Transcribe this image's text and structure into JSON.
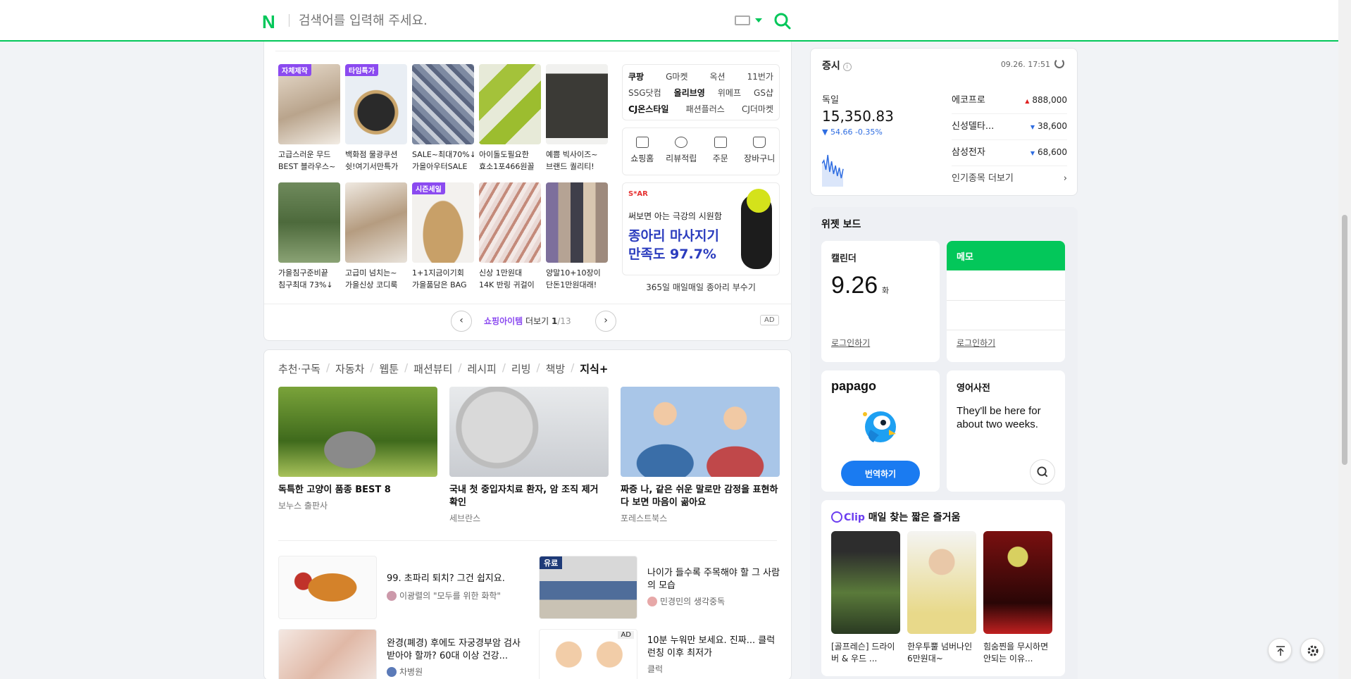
{
  "header": {
    "logo": "N",
    "search_placeholder": "검색어를 입력해 주세요."
  },
  "shopping": {
    "products": [
      {
        "badge": "자체제작",
        "line1": "고급스러운 무드",
        "line2": "BEST 블라우스~"
      },
      {
        "badge": "타임특가",
        "line1": "백화점 물광쿠션",
        "line2": "쉿!여기서만특가"
      },
      {
        "badge": "",
        "line1": "SALE~최대70%↓",
        "line2": "가을아우터SALE"
      },
      {
        "badge": "",
        "line1": "아이돌도필요한",
        "line2": "효소1포466원꼴"
      },
      {
        "badge": "",
        "line1": "예쁨 빅사이즈~",
        "line2": "브랜드 퀄리티!"
      },
      {
        "badge": "",
        "line1": "가을침구준비끝",
        "line2": "침구최대 73%↓"
      },
      {
        "badge": "",
        "line1": "고급미 넘치는~",
        "line2": "가을신상 코디룩"
      },
      {
        "badge": "시즌세일",
        "line1": "1+1지금이기회",
        "line2": "가을품담은 BAG"
      },
      {
        "badge": "",
        "line1": "신상 1만원대",
        "line2": "14K 반링 귀걸이"
      },
      {
        "badge": "",
        "line1": "양말10+10장이",
        "line2": "단돈1만원대래!"
      }
    ],
    "malls": [
      [
        "쿠팡",
        "G마켓",
        "옥션",
        "11번가"
      ],
      [
        "SSG닷컴",
        "올리브영",
        "위메프",
        "GS샵"
      ],
      [
        "CJ온스타일",
        "패션플러스",
        "CJ더마켓"
      ]
    ],
    "shortcuts": [
      "쇼핑홈",
      "리뷰적립",
      "주문",
      "장바구니"
    ],
    "ad": {
      "brand": "S*AR",
      "line1": "써보면 아는 극강의 시원함",
      "line2": "종아리 마사지기",
      "line3": "만족도 97.7%",
      "caption": "365일 매일매일 종아리 부수기"
    },
    "pager": {
      "prev": "‹",
      "next": "›",
      "accent": "쇼핑아이템",
      "more": "더보기",
      "current": "1",
      "total": "/13",
      "ad_tag": "AD"
    }
  },
  "content": {
    "tabs": [
      "추천·구독",
      "자동차",
      "웹툰",
      "패션뷰티",
      "레시피",
      "리빙",
      "책방",
      "지식+"
    ],
    "features": [
      {
        "title": "독특한 고양이 품종 BEST 8",
        "source": "보누스 출판사"
      },
      {
        "title": "국내 첫 중입자치료 환자, 암 조직 제거 확인",
        "source": "세브란스"
      },
      {
        "title": "짜증 나, 같은 쉬운 말로만 감정을 표현하다 보면 마음이 곪아요",
        "source": "포레스트북스"
      }
    ],
    "articles": [
      {
        "title": "99. 초파리 퇴치? 그건 쉽지요.",
        "source": "이광렬의 \"모두를 위한 화학\""
      },
      {
        "badge": "유료",
        "title": "나이가 들수록 주목해야 할 그 사람의 모습",
        "source": "민경민의 생각중독"
      },
      {
        "title": "완경(폐경) 후에도 자궁경부암 검사받아야 할까? 60대 이상 건강...",
        "source": "차병원"
      },
      {
        "title": "10분 누워만 보세요. 진짜... 클럭 런칭 이후 최저가",
        "source": "클럭",
        "ad": "AD"
      }
    ]
  },
  "stocks": {
    "title": "증시",
    "info": "i",
    "time": "09.26. 17:51",
    "index_name": "독일",
    "index_value": "15,350.83",
    "index_change": "▼ 54.66  -0.35%",
    "list": [
      {
        "name": "에코프로",
        "dir": "▲",
        "price": "888,000"
      },
      {
        "name": "신성델타...",
        "dir": "▼",
        "price": "38,600"
      },
      {
        "name": "삼성전자",
        "dir": "▼",
        "price": "68,600"
      }
    ],
    "more": "인기종목 더보기",
    "more_arrow": "›",
    "sparkline": [
      0.55,
      0.62,
      0.4,
      0.75,
      0.35,
      0.6,
      0.3,
      0.5,
      0.25,
      0.45,
      0.2,
      0.42
    ]
  },
  "widgets": {
    "title": "위젯 보드",
    "calendar": {
      "label": "캘린더",
      "date": "9.26",
      "day": "화",
      "login": "로그인하기"
    },
    "memo": {
      "label": "메모",
      "login": "로그인하기"
    },
    "papago": {
      "logo": "papago",
      "button": "번역하기"
    },
    "dict": {
      "label": "영어사전",
      "text": "They'll be here for about two weeks."
    },
    "clip": {
      "brand": "Clip",
      "subtitle": "매일 찾는 짧은 즐거움",
      "items": [
        {
          "caption": "[골프레슨] 드라이버 & 우드 ..."
        },
        {
          "caption": "한우투뿔 넘버나인 6만원대~"
        },
        {
          "caption": "힘숨찐을 무시하면 안되는 이유..."
        }
      ]
    }
  },
  "colors": {
    "brand": "#03c75a",
    "accent_purple": "#8b4af0",
    "up": "#e02020",
    "down": "#2f6de1"
  }
}
